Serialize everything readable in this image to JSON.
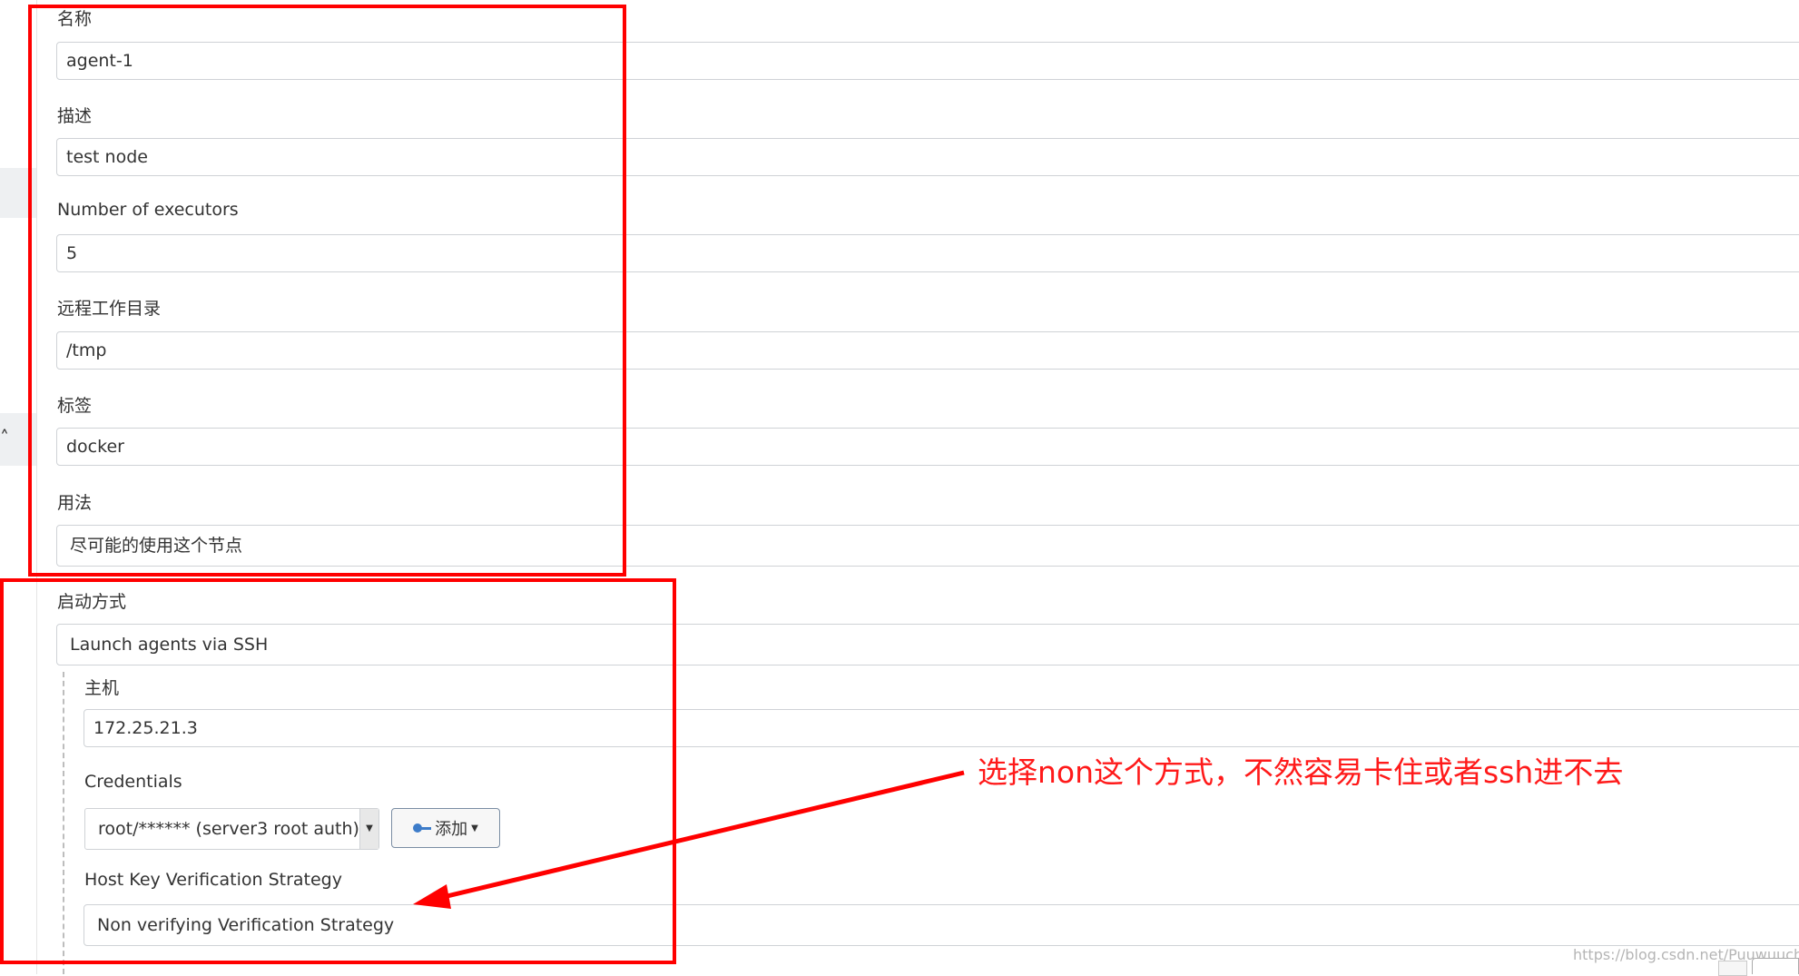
{
  "form": {
    "name_label": "名称",
    "name_value": "agent-1",
    "description_label": "描述",
    "description_value": "test node",
    "executors_label": "Number of executors",
    "executors_value": "5",
    "remote_dir_label": "远程工作目录",
    "remote_dir_value": "/tmp",
    "labels_label": "标签",
    "labels_value": "docker",
    "usage_label": "用法",
    "usage_value": "尽可能的使用这个节点",
    "launch_label": "启动方式",
    "launch_value": "Launch agents via SSH",
    "host_label": "主机",
    "host_value": "172.25.21.3",
    "credentials_label": "Credentials",
    "credentials_value": "root/****** (server3 root auth)",
    "add_button_label": "添加",
    "host_key_label": "Host Key Verification Strategy",
    "host_key_value": "Non verifying Verification Strategy"
  },
  "annotation": {
    "text": "选择non这个方式，不然容易卡住或者ssh进不去",
    "color": "#ff0000"
  },
  "watermark": "https://blog.csdn.net/Puuwuuchao",
  "icons": {
    "add": "key-icon",
    "dropdown": "caret-down-icon",
    "collapse": "chevron-icon"
  }
}
